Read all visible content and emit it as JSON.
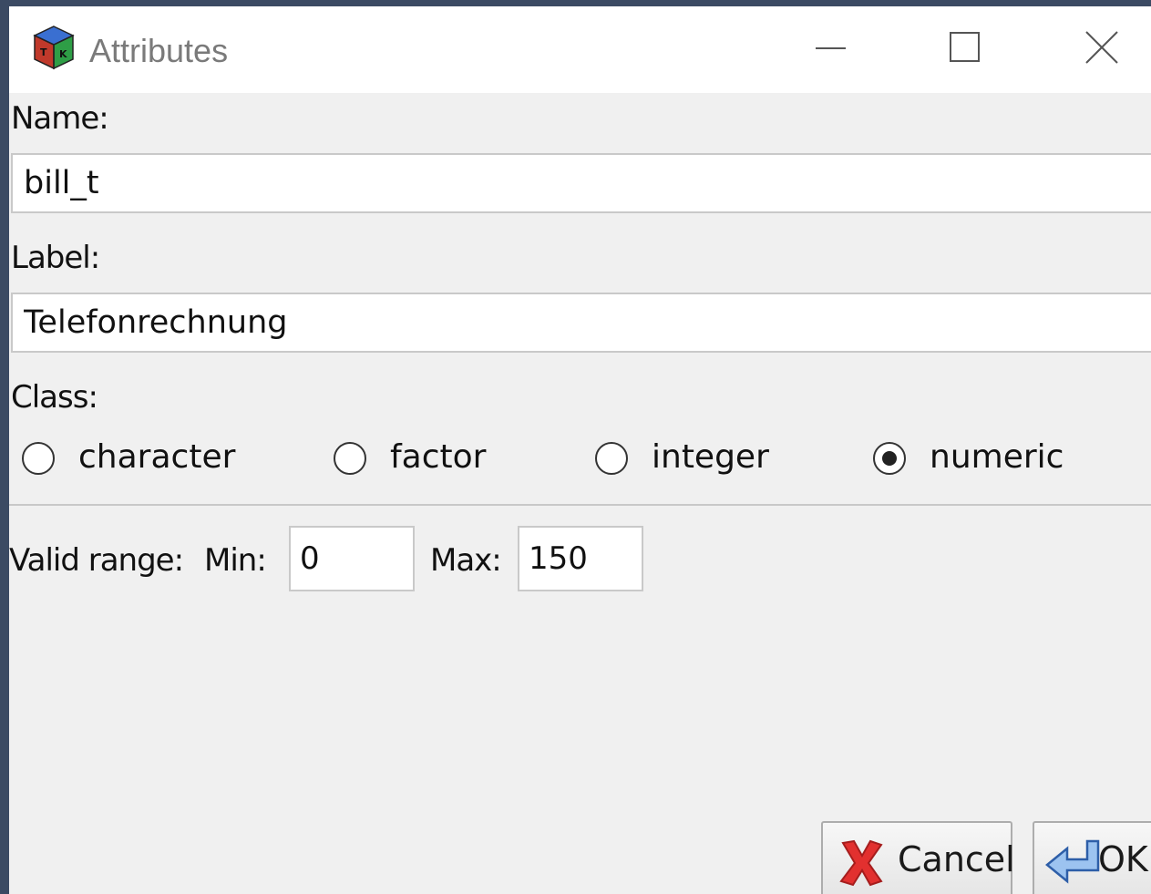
{
  "window": {
    "title": "Attributes",
    "icon": "app-cube-icon",
    "controls": {
      "minimize": "minimize-icon",
      "maximize": "maximize-icon",
      "close": "close-icon"
    }
  },
  "form": {
    "name_label": "Name:",
    "name_value": "bill_t",
    "label_label": "Label:",
    "label_value": "Telefonrechnung",
    "class_label": "Class:",
    "class_options": [
      {
        "label": "character",
        "checked": false
      },
      {
        "label": "factor",
        "checked": false
      },
      {
        "label": "integer",
        "checked": false
      },
      {
        "label": "numeric",
        "checked": true
      }
    ],
    "valid_range_label": "Valid range:",
    "min_label": "Min:",
    "min_value": "0",
    "max_label": "Max:",
    "max_value": "150"
  },
  "buttons": {
    "cancel_label": "Cancel",
    "cancel_icon": "cancel-x-icon",
    "ok_label": "OK",
    "ok_icon": "enter-arrow-icon"
  },
  "colors": {
    "background": "#3b4a63",
    "dialog": "#f0f0f0",
    "cancel_icon": "#e2302f",
    "ok_icon": "#4a86d8"
  }
}
